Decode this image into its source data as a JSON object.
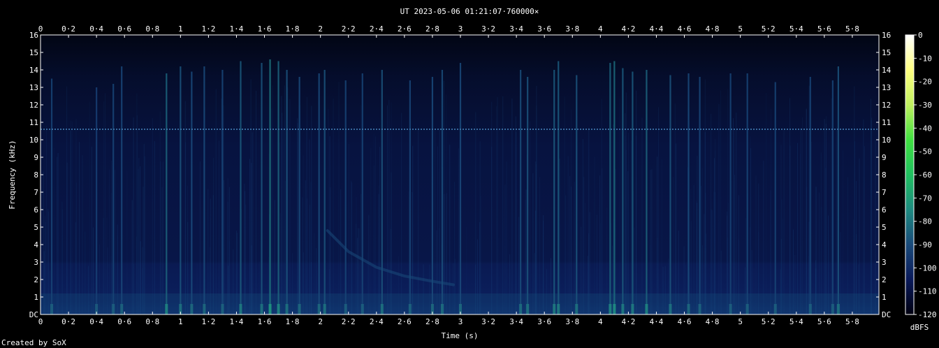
{
  "chart_data": {
    "type": "heatmap",
    "title": "UT 2023-05-06 01:21:07·760000×",
    "xlabel": "Time (s)",
    "ylabel": "Frequency (kHz)",
    "colorbar_label": "dBFS",
    "credit": "Created by SoX",
    "xlim": [
      0,
      5.99
    ],
    "ylim": [
      0,
      16
    ],
    "x_ticks": [
      0,
      0.2,
      0.4,
      0.6,
      0.8,
      1,
      1.2,
      1.4,
      1.6,
      1.8,
      2,
      2.2,
      2.4,
      2.6,
      2.8,
      3,
      3.2,
      3.4,
      3.6,
      3.8,
      4,
      4.2,
      4.4,
      4.6,
      4.8,
      5,
      5.2,
      5.4,
      5.6,
      5.8
    ],
    "x_tick_labels": [
      "0",
      "0·2",
      "0·4",
      "0·6",
      "0·8",
      "1",
      "1·2",
      "1·4",
      "1·6",
      "1·8",
      "2",
      "2·2",
      "2·4",
      "2·6",
      "2·8",
      "3",
      "3·2",
      "3·4",
      "3·6",
      "3·8",
      "4",
      "4·2",
      "4·4",
      "4·6",
      "4·8",
      "5",
      "5·2",
      "5·4",
      "5·6",
      "5·8"
    ],
    "y_ticks": [
      0,
      1,
      2,
      3,
      4,
      5,
      6,
      7,
      8,
      9,
      10,
      11,
      12,
      13,
      14,
      15,
      16
    ],
    "y_tick_labels": [
      "DC",
      "1",
      "2",
      "3",
      "4",
      "5",
      "6",
      "7",
      "8",
      "9",
      "10",
      "11",
      "12",
      "13",
      "14",
      "15",
      "16"
    ],
    "colorbar_ticks": [
      0,
      -10,
      -20,
      -30,
      -40,
      -50,
      -60,
      -70,
      -80,
      -90,
      -100,
      -110,
      -120
    ],
    "colorbar_range": [
      -120,
      0
    ],
    "colorbar_colors": [
      "#000010",
      "#0a1a5a",
      "#1a4a7a",
      "#1e8a80",
      "#20c060",
      "#40e040",
      "#c0f060",
      "#ffff80",
      "#ffffff"
    ],
    "narrowband_line_khz": 10.6,
    "impulses": [
      {
        "t": 0.08,
        "top": 13.5,
        "level": -92
      },
      {
        "t": 0.4,
        "top": 13.0,
        "level": -93
      },
      {
        "t": 0.52,
        "top": 13.2,
        "level": -92
      },
      {
        "t": 0.58,
        "top": 14.2,
        "level": -91
      },
      {
        "t": 0.9,
        "top": 13.8,
        "level": -84
      },
      {
        "t": 1.0,
        "top": 14.2,
        "level": -88
      },
      {
        "t": 1.08,
        "top": 13.9,
        "level": -90
      },
      {
        "t": 1.17,
        "top": 14.2,
        "level": -90
      },
      {
        "t": 1.3,
        "top": 14.0,
        "level": -91
      },
      {
        "t": 1.43,
        "top": 14.5,
        "level": -86
      },
      {
        "t": 1.58,
        "top": 14.4,
        "level": -88
      },
      {
        "t": 1.64,
        "top": 14.6,
        "level": -80
      },
      {
        "t": 1.7,
        "top": 14.5,
        "level": -84
      },
      {
        "t": 1.76,
        "top": 14.0,
        "level": -88
      },
      {
        "t": 1.85,
        "top": 13.6,
        "level": -90
      },
      {
        "t": 1.99,
        "top": 13.8,
        "level": -90
      },
      {
        "t": 2.03,
        "top": 14.0,
        "level": -88
      },
      {
        "t": 2.18,
        "top": 13.4,
        "level": -92
      },
      {
        "t": 2.3,
        "top": 13.8,
        "level": -92
      },
      {
        "t": 2.44,
        "top": 14.0,
        "level": -88
      },
      {
        "t": 2.64,
        "top": 13.4,
        "level": -91
      },
      {
        "t": 2.8,
        "top": 13.6,
        "level": -90
      },
      {
        "t": 2.87,
        "top": 14.0,
        "level": -89
      },
      {
        "t": 3.0,
        "top": 14.4,
        "level": -90
      },
      {
        "t": 3.43,
        "top": 14.0,
        "level": -89
      },
      {
        "t": 3.48,
        "top": 13.6,
        "level": -88
      },
      {
        "t": 3.67,
        "top": 14.0,
        "level": -86
      },
      {
        "t": 3.7,
        "top": 14.5,
        "level": -86
      },
      {
        "t": 3.83,
        "top": 13.7,
        "level": -88
      },
      {
        "t": 4.07,
        "top": 14.4,
        "level": -84
      },
      {
        "t": 4.1,
        "top": 14.5,
        "level": -82
      },
      {
        "t": 4.16,
        "top": 14.1,
        "level": -86
      },
      {
        "t": 4.23,
        "top": 13.9,
        "level": -86
      },
      {
        "t": 4.33,
        "top": 14.0,
        "level": -84
      },
      {
        "t": 4.5,
        "top": 13.7,
        "level": -88
      },
      {
        "t": 4.63,
        "top": 13.8,
        "level": -90
      },
      {
        "t": 4.71,
        "top": 13.6,
        "level": -91
      },
      {
        "t": 4.93,
        "top": 13.8,
        "level": -92
      },
      {
        "t": 5.05,
        "top": 13.8,
        "level": -92
      },
      {
        "t": 5.25,
        "top": 13.3,
        "level": -92
      },
      {
        "t": 5.5,
        "top": 13.6,
        "level": -92
      },
      {
        "t": 5.66,
        "top": 13.4,
        "level": -92
      },
      {
        "t": 5.7,
        "top": 14.2,
        "level": -88
      }
    ],
    "whistler": {
      "points": [
        [
          2.05,
          4.8
        ],
        [
          2.2,
          3.6
        ],
        [
          2.4,
          2.7
        ],
        [
          2.6,
          2.2
        ],
        [
          2.8,
          1.9
        ],
        [
          2.95,
          1.7
        ]
      ],
      "level": -90
    }
  }
}
